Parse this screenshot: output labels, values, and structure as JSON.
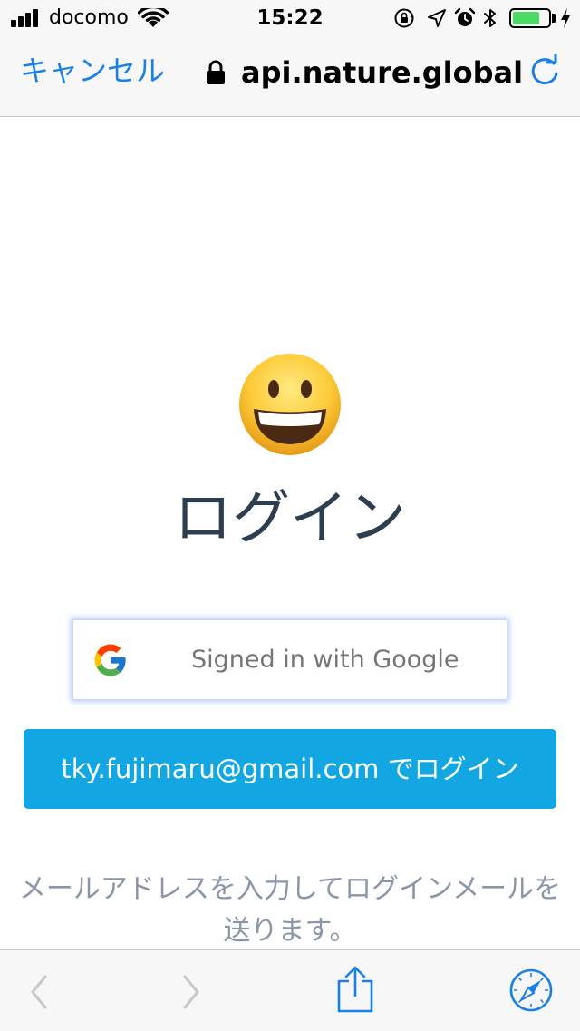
{
  "status_bar": {
    "carrier": "docomo",
    "time": "15:22",
    "battery_level": 0.75,
    "battery_color": "#4cd964",
    "icons": [
      "signal-icon",
      "wifi-icon",
      "rotation-lock-icon",
      "location-icon",
      "alarm-icon",
      "bluetooth-icon",
      "battery-icon",
      "charging-icon"
    ]
  },
  "nav": {
    "cancel_label": "キャンセル",
    "url": "api.nature.global",
    "icons": [
      "lock-icon",
      "reload-icon"
    ],
    "accent_color": "#1a7fe6"
  },
  "content": {
    "emoji_icon": "smiling-face-icon",
    "title": "ログイン",
    "google_button_label": "Signed in with Google",
    "email_button_label": "tky.fujimaru@gmail.com でログイン",
    "email_button_color": "#12a7e2",
    "hint_line1": "メールアドレスを入力してログインメールを",
    "hint_line2": "送ります。"
  },
  "toolbar": {
    "icons": [
      "back-arrow-icon",
      "forward-arrow-icon",
      "share-icon",
      "safari-compass-icon"
    ]
  }
}
